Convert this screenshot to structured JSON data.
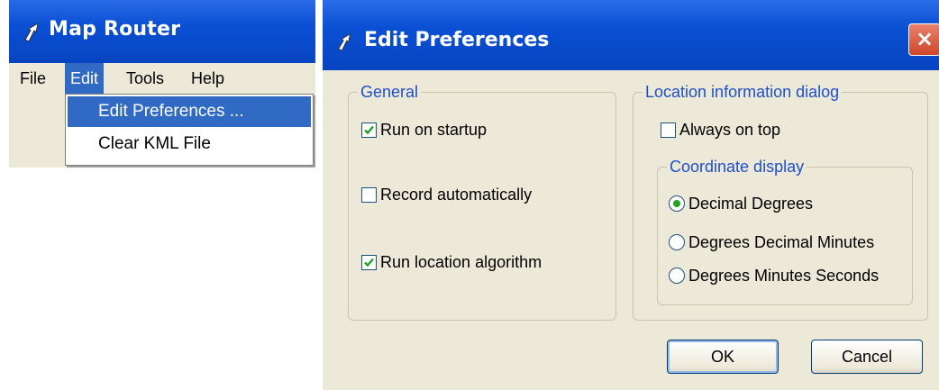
{
  "main_window": {
    "title": "Map Router",
    "menubar": [
      "File",
      "Edit",
      "Tools",
      "Help"
    ],
    "active_menu": "Edit",
    "edit_menu_items": [
      "Edit Preferences ...",
      "Clear KML File"
    ],
    "highlighted_item": "Edit Preferences ..."
  },
  "dialog": {
    "title": "Edit Preferences",
    "close_label": "×",
    "general": {
      "legend": "General",
      "run_on_startup": {
        "label": "Run on startup",
        "checked": true
      },
      "record_automatically": {
        "label": "Record automatically",
        "checked": false
      },
      "run_location_algorithm": {
        "label": "Run location algorithm",
        "checked": true
      }
    },
    "location_info": {
      "legend": "Location information dialog",
      "always_on_top": {
        "label": "Always on top",
        "checked": false
      },
      "coordinate_display": {
        "legend": "Coordinate display",
        "options": [
          "Decimal Degrees",
          "Degrees Decimal Minutes",
          "Degrees Minutes Seconds"
        ],
        "selected": "Decimal Degrees"
      }
    },
    "ok_label": "OK",
    "cancel_label": "Cancel"
  },
  "icons": {
    "app": "map-router-arrow-icon",
    "close": "close-icon",
    "check": "check-icon"
  },
  "colors": {
    "titlebar": "#0a4fd4",
    "menu_highlight": "#316ac5",
    "dialog_bg": "#ece9d8",
    "legend_text": "#1f4fc9",
    "check_green": "#21a121",
    "close_red": "#d0462a"
  }
}
